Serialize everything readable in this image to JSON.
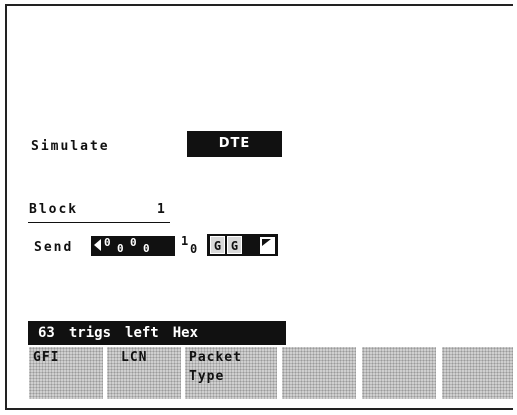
{
  "simulate": {
    "label": "Simulate",
    "value": "DTE"
  },
  "block": {
    "label": "Block",
    "number": "1"
  },
  "send": {
    "label": "Send",
    "bits": [
      "0",
      "0",
      "0",
      "0"
    ],
    "tail_bit": "1",
    "tail_sub": "0",
    "fields": [
      "G",
      "G"
    ]
  },
  "status": {
    "count": "63",
    "word1": "trigs",
    "word2": "left",
    "mode": "Hex"
  },
  "softkeys": [
    {
      "line1": "GFI",
      "line2": ""
    },
    {
      "line1": "LCN",
      "line2": ""
    },
    {
      "line1": "Packet",
      "line2": "Type"
    },
    {
      "line1": "",
      "line2": ""
    },
    {
      "line1": "",
      "line2": ""
    },
    {
      "line1": "",
      "line2": ""
    }
  ]
}
